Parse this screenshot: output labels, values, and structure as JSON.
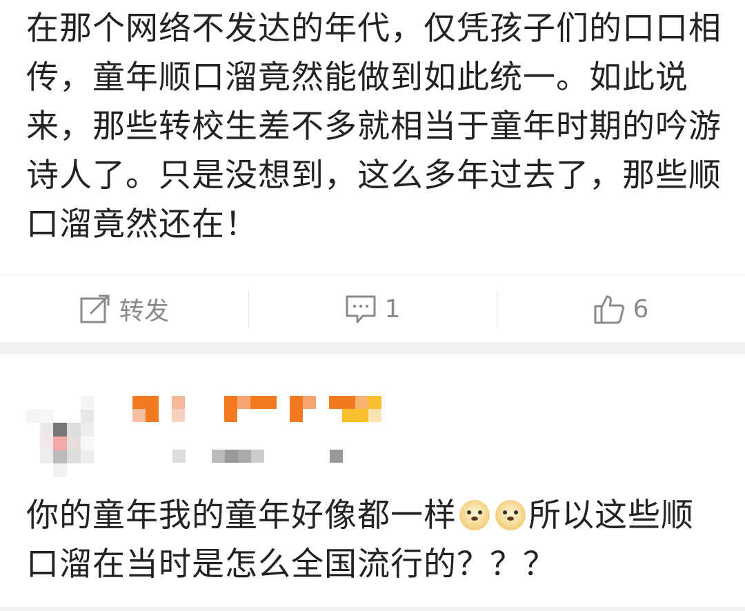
{
  "post": {
    "text": "在那个网络不发达的年代，仅凭孩子们的口口相传，童年顺口溜竟然能做到如此统一。如此说来，那些转校生差不多就相当于童年时期的吟游诗人了。只是没想到，这么多年过去了，那些顺口溜竟然还在！"
  },
  "actions": {
    "repost_label": "转发",
    "comment_count": "1",
    "like_count": "6"
  },
  "comment": {
    "text_before_emoji": "你的童年我的童年好像都一样",
    "emoji_name": "doge-emoji",
    "text_after_emoji": "所以这些顺口溜在当时是怎么全国流行的？？？"
  },
  "colors": {
    "icon_gray": "#8a8a8a",
    "separator": "#f2f2f2",
    "mosaic_orange": "#f47a1f",
    "mosaic_yellow": "#f7c02c"
  }
}
